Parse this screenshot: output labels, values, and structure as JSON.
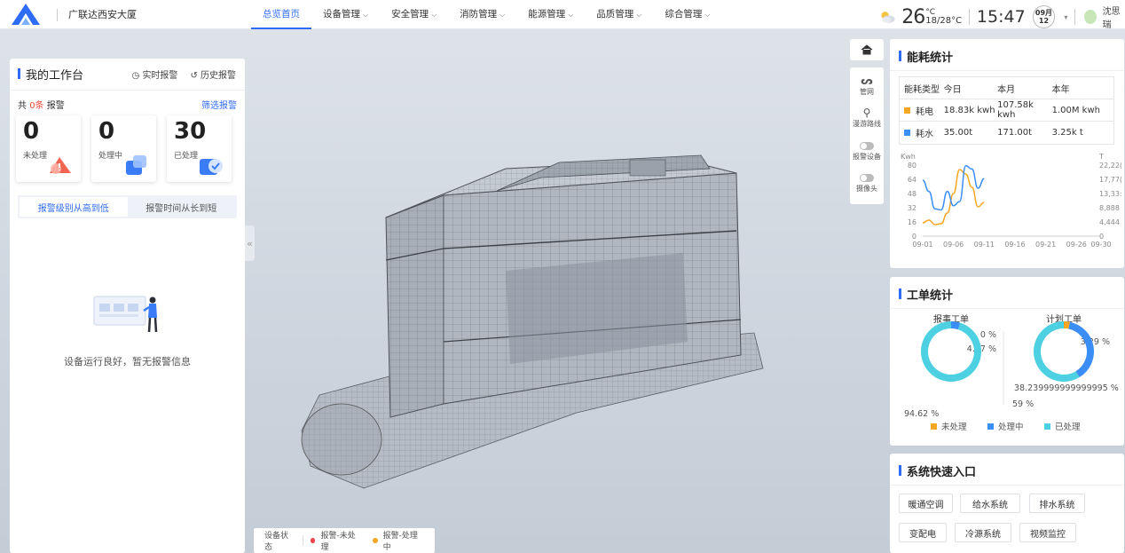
{
  "app": {
    "name": "广联达西安大厦"
  },
  "nav": {
    "items": [
      {
        "label": "总览首页"
      },
      {
        "label": "设备管理"
      },
      {
        "label": "安全管理"
      },
      {
        "label": "消防管理"
      },
      {
        "label": "能源管理"
      },
      {
        "label": "品质管理"
      },
      {
        "label": "综合管理"
      }
    ]
  },
  "weather": {
    "icon": "partly-cloudy-icon",
    "temp": "26",
    "unit": "°C",
    "range": "18/28°C"
  },
  "clock": {
    "time": "15:47",
    "month": "09月",
    "day": "12"
  },
  "user": {
    "name": "沈思瑞"
  },
  "workbench": {
    "title": "我的工作台",
    "realtime_label": "实时报警",
    "history_label": "历史报警",
    "total_prefix": "共 ",
    "total_count": "0条",
    "total_suffix": " 报警",
    "filter_label": "筛选报警",
    "stats": [
      {
        "value": "0",
        "label": "未处理",
        "color": "#f0533f"
      },
      {
        "value": "0",
        "label": "处理中",
        "color": "#3a7cf5"
      },
      {
        "value": "30",
        "label": "已处理",
        "color": "#3a7cf5"
      }
    ],
    "sort_tabs": [
      {
        "label": "报警级别从高到低"
      },
      {
        "label": "报警时间从长到短"
      }
    ],
    "empty_text": "设备运行良好，暂无报警信息"
  },
  "collapse": {
    "glyph": "«"
  },
  "status_bar": {
    "label": "设备状态",
    "items": [
      {
        "label": "报警-未处理",
        "color": "#f0434b"
      },
      {
        "label": "报警-处理中",
        "color": "#f5a623"
      }
    ]
  },
  "toolbox": {
    "home_icon": "home-icon",
    "items": [
      {
        "label": "管网",
        "icon": "pipe-icon"
      },
      {
        "label": "漫游路线",
        "icon": "location-icon"
      },
      {
        "label": "报警设备",
        "icon": "toggle-icon"
      },
      {
        "label": "摄像头",
        "icon": "toggle-icon"
      }
    ]
  },
  "energy": {
    "title": "能耗统计",
    "headers": [
      "能耗类型",
      "今日",
      "本月",
      "本年"
    ],
    "rows": [
      {
        "type": "耗电",
        "color": "#f5a623",
        "today": "18.83k kwh",
        "month": "107.58k kwh",
        "year": "1.00M kwh"
      },
      {
        "type": "耗水",
        "color": "#3a8ef5",
        "today": "35.00t",
        "month": "171.00t",
        "year": "3.25k t"
      }
    ]
  },
  "chart_data": {
    "type": "line",
    "x": [
      "09-01",
      "09-02",
      "09-03",
      "09-04",
      "09-05",
      "09-06",
      "09-07",
      "09-08",
      "09-09",
      "09-10",
      "09-11"
    ],
    "xticks": [
      "09-01",
      "09-06",
      "09-11",
      "09-16",
      "09-21",
      "09-26",
      "09-30"
    ],
    "ylabel_left": "Kwh",
    "ylabel_right": "T",
    "yticks_left": [
      "0",
      "16",
      "32",
      "48",
      "64",
      "80"
    ],
    "yticks_right": [
      "0",
      "4,444",
      "8,888",
      "13,33:",
      "17,77(",
      "22,22("
    ],
    "ylim_left": [
      0,
      80
    ],
    "series": [
      {
        "color": "#f5a623",
        "axis": "left",
        "values": [
          15,
          18,
          13,
          14,
          26,
          48,
          75,
          70,
          55,
          33,
          38
        ]
      },
      {
        "color": "#3a8ef5",
        "axis": "right",
        "values": [
          17500,
          14000,
          8500,
          8200,
          14000,
          9500,
          10800,
          22000,
          21000,
          15000,
          18000
        ]
      }
    ]
  },
  "orders": {
    "title": "工单统计",
    "charts": [
      {
        "title": "报事工单",
        "slices": [
          {
            "value": 0,
            "label": "0 %"
          },
          {
            "value": 4.87,
            "label": "4.87 %"
          },
          {
            "value": 94.62,
            "label": "94.62 %"
          }
        ]
      },
      {
        "title": "计划工单",
        "slices": [
          {
            "value": 3.29,
            "label": "3.29 %"
          },
          {
            "value": 38.23,
            "label": "38.239999999999995 %"
          },
          {
            "value": 59,
            "label": "59 %"
          }
        ]
      }
    ],
    "legend": [
      {
        "label": "未处理",
        "color": "#f5a623"
      },
      {
        "label": "处理中",
        "color": "#3a8ef5"
      },
      {
        "label": "已处理",
        "color": "#4dd0e1"
      }
    ]
  },
  "quick": {
    "title": "系统快速入口",
    "buttons": [
      "暖通空调",
      "给水系统",
      "排水系统",
      "变配电",
      "冷源系统",
      "视频监控"
    ]
  }
}
